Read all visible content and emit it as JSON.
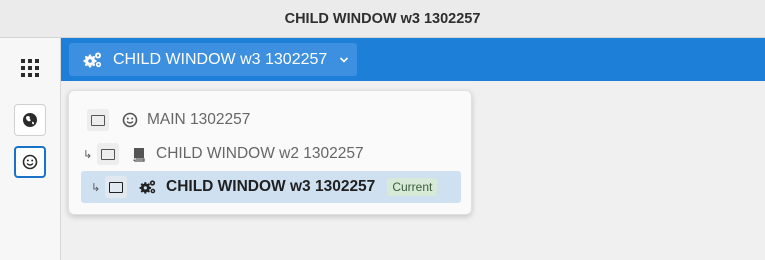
{
  "window": {
    "title": "CHILD WINDOW w3 1302257"
  },
  "rail": {
    "apps_icon": "grid-icon",
    "buttons": [
      {
        "icon": "globe-icon",
        "active": false
      },
      {
        "icon": "smiley-icon",
        "active": true
      }
    ]
  },
  "switcher": {
    "label": "CHILD WINDOW w3 1302257",
    "icon": "gears-icon",
    "chevron": "chevron-down-icon"
  },
  "window_list": [
    {
      "label": "MAIN 1302257",
      "icon": "smiley-icon",
      "indent": false,
      "current": false
    },
    {
      "label": "CHILD WINDOW w2 1302257",
      "icon": "book-icon",
      "indent": true,
      "current": false
    },
    {
      "label": "CHILD WINDOW w3 1302257",
      "icon": "gears-icon",
      "indent": true,
      "current": true,
      "badge": "Current"
    }
  ],
  "colors": {
    "accent": "#1e7fd8",
    "current_row": "#cfe0f1",
    "badge_bg": "#d7ead8"
  }
}
